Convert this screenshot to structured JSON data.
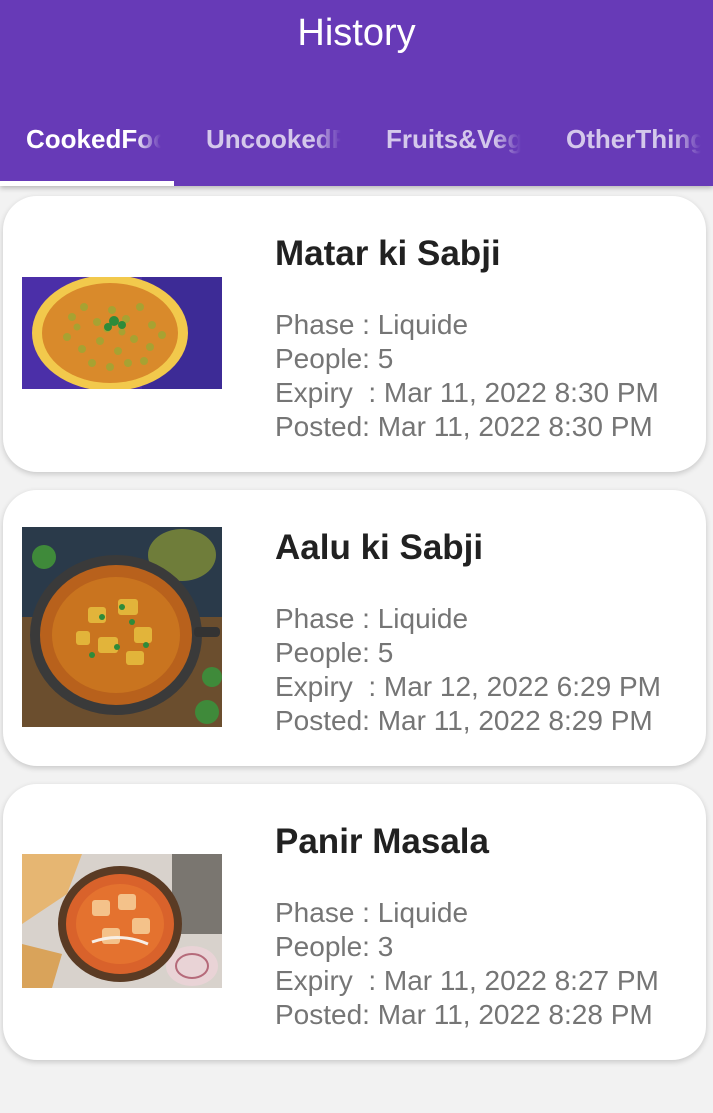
{
  "appbar": {
    "title": "History"
  },
  "tabs": [
    {
      "label": "CookedFood",
      "active": true
    },
    {
      "label": "UncookedFood",
      "active": false
    },
    {
      "label": "Fruits&Vegetables",
      "active": false
    },
    {
      "label": "OtherThings",
      "active": false
    }
  ],
  "cards": [
    {
      "title": "Matar ki Sabji",
      "image": "green-peas-curry-image",
      "phase": "Phase : Liquide",
      "people": "People: 5",
      "expiry": "Expiry  : Mar 11, 2022 8:30 PM",
      "posted": "Posted: Mar 11, 2022 8:30 PM"
    },
    {
      "title": "Aalu ki Sabji",
      "image": "potato-curry-image",
      "phase": "Phase : Liquide",
      "people": "People: 5",
      "expiry": "Expiry  : Mar 12, 2022 6:29 PM",
      "posted": "Posted: Mar 11, 2022 8:29 PM"
    },
    {
      "title": "Panir Masala",
      "image": "paneer-masala-image",
      "phase": "Phase : Liquide",
      "people": "People: 3",
      "expiry": "Expiry  : Mar 11, 2022 8:27 PM",
      "posted": "Posted: Mar 11, 2022 8:28 PM"
    }
  ],
  "colors": {
    "primary": "#673ab7",
    "title_text": "#212121",
    "detail_text": "#757575"
  }
}
